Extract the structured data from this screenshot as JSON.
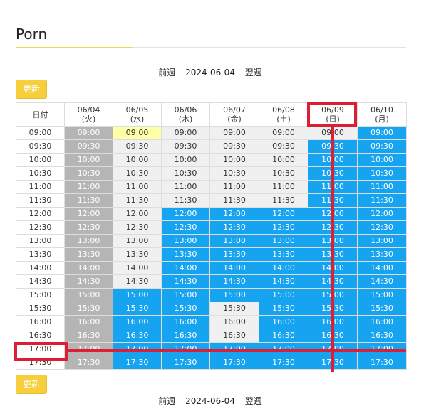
{
  "page": {
    "title": "Porn"
  },
  "week_nav": {
    "prev": "前週",
    "date": "2024-06-04",
    "next": "翌週"
  },
  "refresh_label": "更新",
  "timetable": {
    "corner_label": "日付",
    "days": [
      {
        "date": "06/04",
        "weekday": "(火)"
      },
      {
        "date": "06/05",
        "weekday": "(水)"
      },
      {
        "date": "06/06",
        "weekday": "(木)"
      },
      {
        "date": "06/07",
        "weekday": "(金)"
      },
      {
        "date": "06/08",
        "weekday": "(土)"
      },
      {
        "date": "06/09",
        "weekday": "(日)"
      },
      {
        "date": "06/10",
        "weekday": "(月)"
      }
    ],
    "times": [
      "09:00",
      "09:30",
      "10:00",
      "10:30",
      "11:00",
      "11:30",
      "12:00",
      "12:30",
      "13:00",
      "13:30",
      "14:00",
      "14:30",
      "15:00",
      "15:30",
      "16:00",
      "16:30",
      "17:00",
      "17:30"
    ],
    "status_codes": {
      "a": "available",
      "p": "past",
      "b": "booked",
      "s": "selected"
    },
    "status_colors": {
      "available": "#f0f0f0",
      "past": "#b5b5b5",
      "booked": "#16a3f0",
      "selected": "#ffffa8"
    },
    "rows": [
      "psaaaab",
      "paaaabb",
      "paaaabb",
      "paaaabb",
      "paaaabb",
      "paaaabb",
      "pabbbbb",
      "pabbbbb",
      "pabbbbb",
      "pabbbbb",
      "pabbbbb",
      "pabbbbb",
      "pbbbbbb",
      "pbbabbb",
      "pbbabbb",
      "pbbabbb",
      "pbbbbbb",
      "pbbbbbb"
    ]
  },
  "annotation_color": "#dc1f34"
}
